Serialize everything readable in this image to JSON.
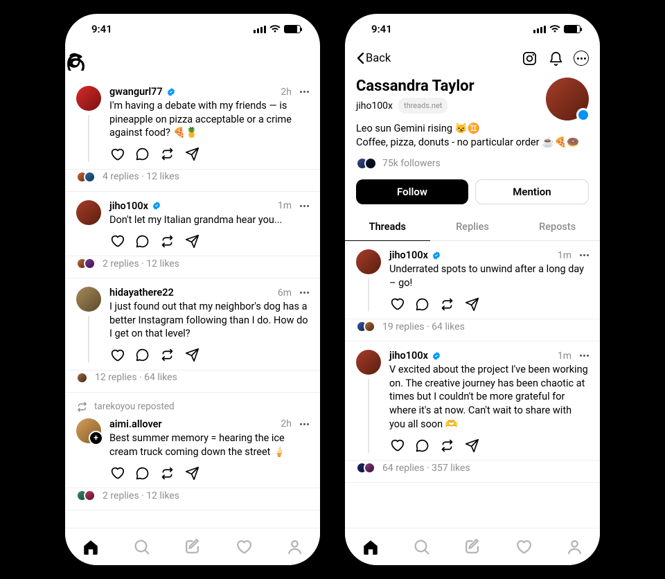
{
  "statusbar": {
    "time": "9:41"
  },
  "feed": {
    "posts": [
      {
        "user": "gwangurl77",
        "verified": true,
        "time": "2h",
        "text": "I'm having a debate with my friends — is pineapple on pizza acceptable or a crime against food? 🍕🍍",
        "replies": "4 replies",
        "likes": "12 likes",
        "avatar": "linear-gradient(135deg,#d62b2b,#7b1010)",
        "thread": true,
        "mini1": "linear-gradient(135deg,#c46b3a,#6a2a10)",
        "mini2": "linear-gradient(135deg,#2a6ea8,#12324d)"
      },
      {
        "user": "jiho100x",
        "verified": true,
        "time": "1m",
        "text": "Don't let my Italian grandma hear you...",
        "replies": "2 replies",
        "likes": "12 likes",
        "avatar": "linear-gradient(135deg,#a63d2a,#5a1e0e)",
        "mini1": "linear-gradient(135deg,#b96b3a,#5a2a10)",
        "mini2": "linear-gradient(135deg,#7a3a8a,#3a124d)"
      },
      {
        "user": "hidayathere22",
        "verified": false,
        "time": "6m",
        "text": "I just found out that my neighbor's dog has a better Instagram following than I do. How do I get on that level?",
        "replies": "12 replies",
        "likes": "64 likes",
        "avatar": "linear-gradient(135deg,#a88a5a,#5a4a2a)",
        "thread": true,
        "single_mini": true,
        "mini1": "linear-gradient(135deg,#9a6a4a,#4a2a10)"
      },
      {
        "reposted_by": "tarekoyou reposted",
        "user": "aimi.allover",
        "verified": false,
        "time": "2h",
        "text": "Best summer memory = hearing the ice cream truck coming down the street 🍦",
        "replies": "2 replies",
        "likes": "12 likes",
        "avatar": "linear-gradient(135deg,#d0a060,#8a5a20)",
        "show_plus": true,
        "mini1": "linear-gradient(135deg,#3a8a6a,#114d3a)",
        "mini2": "linear-gradient(135deg,#b93a6a,#5a102d)"
      }
    ]
  },
  "profile": {
    "back": "Back",
    "name": "Cassandra Taylor",
    "handle": "jiho100x",
    "domain": "threads.net",
    "bio_line1": "Leo sun Gemini rising 😼♊",
    "bio_line2": "Coffee, pizza, donuts - no particular order ☕🍕🍩",
    "followers": "75k followers",
    "follow_btn": "Follow",
    "mention_btn": "Mention",
    "tabs": {
      "threads": "Threads",
      "replies": "Replies",
      "reposts": "Reposts"
    },
    "posts": [
      {
        "user": "jiho100x",
        "verified": true,
        "time": "1m",
        "text": "Underrated spots to unwind after a long day – go!",
        "replies": "19 replies",
        "likes": "64 likes",
        "avatar": "linear-gradient(135deg,#a63d2a,#5a1e0e)",
        "thread": true,
        "mini1": "linear-gradient(135deg,#3a5aaa,#10204d)",
        "mini2": "linear-gradient(135deg,#aa6a3a,#4d2a10)"
      },
      {
        "user": "jiho100x",
        "verified": true,
        "time": "1m",
        "text": "V excited about the project I've been working on. The creative journey has been chaotic at times but I couldn't be more grateful for where it's at now. Can't wait to share with you all soon 🫶",
        "replies": "64 replies",
        "likes": "357 likes",
        "avatar": "linear-gradient(135deg,#a63d2a,#5a1e0e)",
        "thread": true,
        "mini1": "linear-gradient(135deg,#1a2a6a,#0a1030)",
        "mini2": "linear-gradient(135deg,#8a3a7a,#3a103a)"
      }
    ]
  }
}
